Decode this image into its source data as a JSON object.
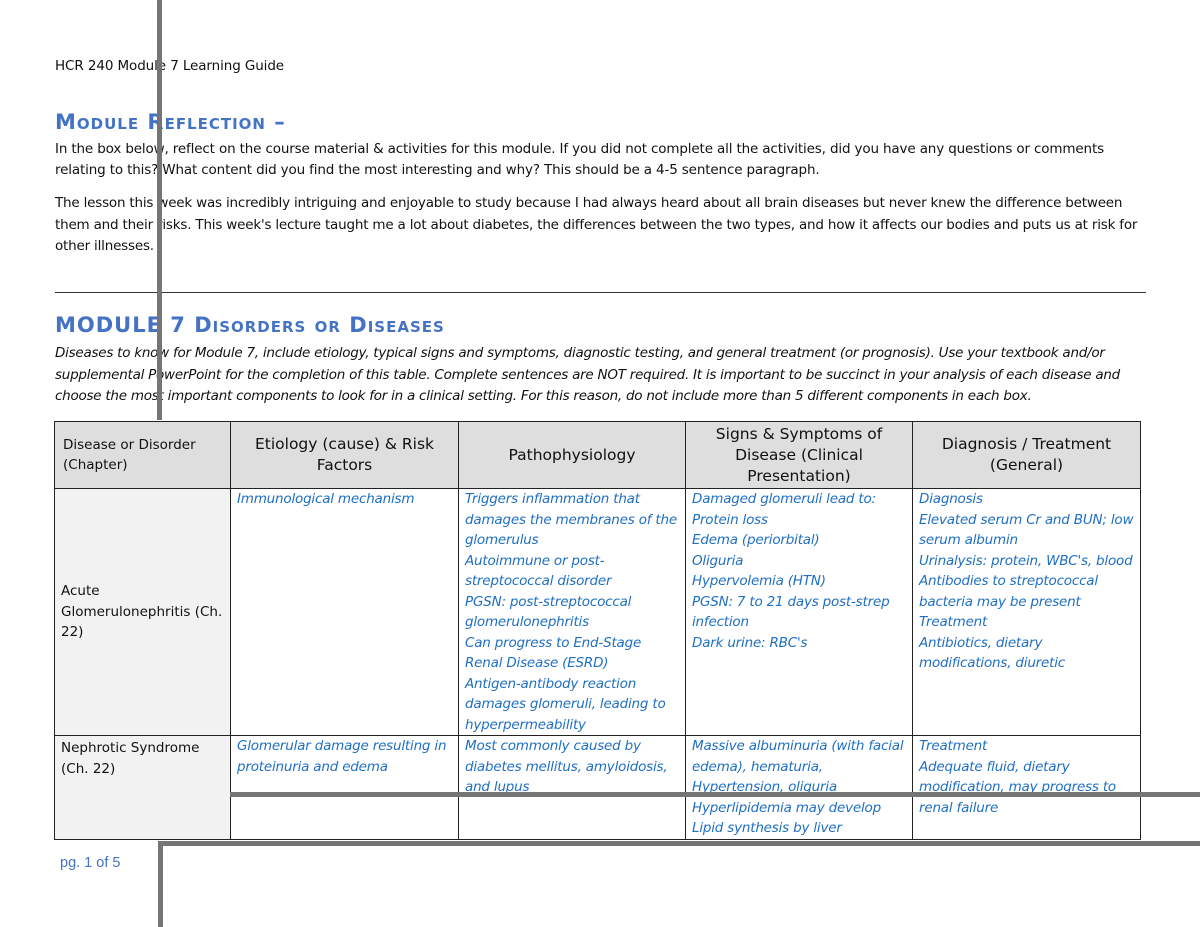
{
  "header": {
    "title": "HCR 240 Module 7 Learning Guide"
  },
  "reflection": {
    "heading": "Module Reflection –",
    "prompt": "In the box below, reflect on the course material & activities for this module.  If you did not complete all the activities, did you have any questions or comments relating to this?  What content did you find the most interesting and why?  This should be a 4-5 sentence paragraph.",
    "answer": "The lesson this week was incredibly intriguing and enjoyable to study because I had always heard about all brain diseases but never knew the difference between them and their risks. This week's lecture taught me a lot about diabetes, the differences between the two types, and how it affects our bodies and puts us at risk for other illnesses."
  },
  "diseases_section": {
    "heading": "MODULE 7 Disorders or Diseases",
    "instructions": "Diseases to know for Module 7, include etiology, typical signs and symptoms, diagnostic testing, and general treatment (or prognosis).  Use your textbook and/or supplemental PowerPoint for the completion of this table.  Complete sentences are NOT required.   It is important to be succinct in your analysis of each disease and choose the most important components to look for in a clinical setting. For this reason, do not include more than 5 different components in each box."
  },
  "table": {
    "headers": [
      "Disease or Disorder (Chapter)",
      "Etiology (cause) & Risk Factors",
      "Pathophysiology",
      "Signs & Symptoms of Disease (Clinical Presentation)",
      "Diagnosis / Treatment (General)"
    ],
    "rows": [
      {
        "disease": "Acute Glomerulonephritis (Ch. 22)",
        "etiology": [
          "Immunological mechanism"
        ],
        "pathophysiology": [
          "Triggers inflammation that damages the membranes of the glomerulus",
          "Autoimmune or post-streptococcal disorder",
          "PGSN: post-streptococcal glomerulonephritis",
          "Can progress to End-Stage Renal Disease (ESRD)",
          "Antigen-antibody reaction damages glomeruli, leading to hyperpermeability"
        ],
        "signs": [
          "Damaged glomeruli lead to:",
          "Protein loss",
          "Edema (periorbital)",
          "Oliguria",
          "Hypervolemia (HTN)",
          "PGSN: 7 to 21 days post-strep infection",
          "Dark urine: RBC's"
        ],
        "diagnosis": [
          "Diagnosis",
          "Elevated serum Cr and BUN; low serum albumin",
          "Urinalysis: protein, WBC's, blood",
          "Antibodies to streptococcal bacteria may be present",
          "Treatment",
          "Antibiotics, dietary modifications, diuretic"
        ]
      },
      {
        "disease": "Nephrotic Syndrome (Ch. 22)",
        "etiology": [
          "Glomerular damage resulting in proteinuria and edema"
        ],
        "pathophysiology": [
          "Most commonly caused by diabetes mellitus, amyloidosis, and lupus"
        ],
        "signs": [
          "Massive albuminuria (with facial edema), hematuria, Hypertension, oliguria",
          "Hyperlipidemia may develop",
          "Lipid synthesis by liver"
        ],
        "diagnosis": [
          "Treatment",
          "Adequate fluid, dietary modification, may progress to renal failure"
        ]
      }
    ]
  },
  "footer": {
    "page_label": "pg. 1 of 5"
  }
}
